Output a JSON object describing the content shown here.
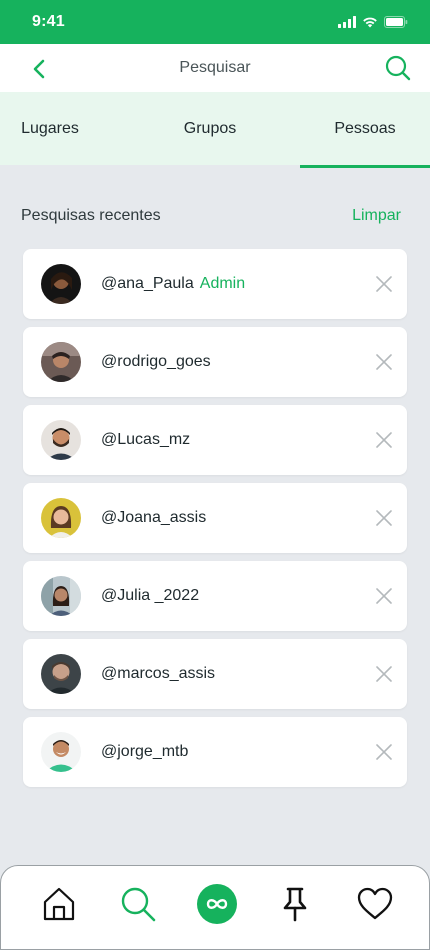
{
  "status_bar": {
    "time": "9:41"
  },
  "header": {
    "title": "Pesquisar"
  },
  "tabs": [
    {
      "label": "Lugares"
    },
    {
      "label": "Grupos"
    },
    {
      "label": "Pessoas",
      "active": true
    }
  ],
  "recent": {
    "title": "Pesquisas recentes",
    "clear_label": "Limpar",
    "items": [
      {
        "username": "@ana_Paula",
        "badge": "Admin"
      },
      {
        "username": "@rodrigo_goes"
      },
      {
        "username": "@Lucas_mz"
      },
      {
        "username": "@Joana_assis"
      },
      {
        "username": "@Julia _2022"
      },
      {
        "username": "@marcos_assis"
      },
      {
        "username": "@jorge_mtb"
      }
    ]
  },
  "colors": {
    "accent": "#16b25d",
    "tabs_background": "#e8f7ee",
    "page_background": "#e6e9ed"
  },
  "bottom_nav": [
    {
      "icon": "home-icon"
    },
    {
      "icon": "search-icon"
    },
    {
      "icon": "infinity-icon"
    },
    {
      "icon": "pin-icon"
    },
    {
      "icon": "heart-icon"
    }
  ]
}
